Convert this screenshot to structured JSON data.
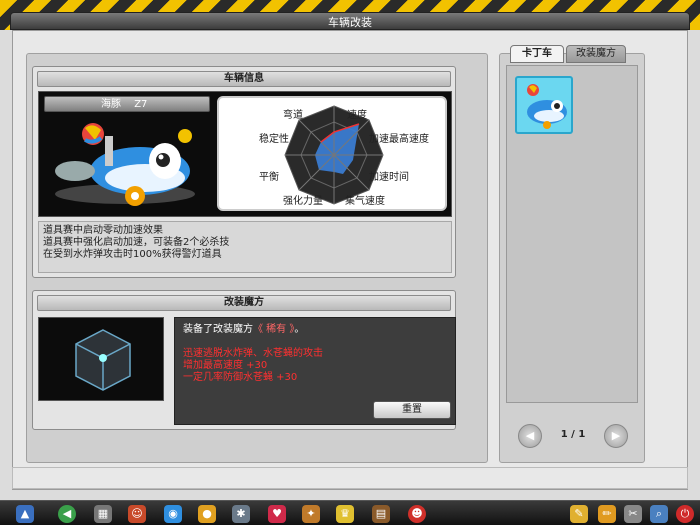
{
  "window": {
    "title": "车辆改装"
  },
  "vehicle_info": {
    "header": "车辆信息",
    "vehicle_name": "海豚",
    "vehicle_level": "Z7",
    "radar_labels": {
      "curve": "弯道",
      "speed": "速度",
      "stability": "稳定性",
      "accel_top_speed": "加速最高速度",
      "balance": "平衡",
      "accel_time": "加速时间",
      "boost_power": "强化力量",
      "gas_speed": "集气速度"
    },
    "description": [
      "道具赛中启动零动加速效果",
      "道具赛中强化启动加速，可装备2个必杀技",
      "在受到水炸弹攻击时100%获得警灯道具"
    ]
  },
  "modification": {
    "header": "改装魔方",
    "equipped_prefix": "装备了改装魔方",
    "equipped_name": "《 稀有 》",
    "equipped_suffix": "。",
    "effects": [
      "迅速逃脱水炸弹、水苍蝇的攻击",
      "增加最高速度 +30",
      "一定几率防御水苍蝇 +30"
    ],
    "reset_button": "重置"
  },
  "right_panel": {
    "tabs": [
      {
        "label": "卡丁车",
        "active": true
      },
      {
        "label": "改装魔方",
        "active": false
      }
    ],
    "pager": {
      "current": "1",
      "separator": "/",
      "total": "1",
      "prev": "◀",
      "next": "▶"
    }
  },
  "colors": {
    "accent_yellow": "#f2c200",
    "effect_red": "#ff3030",
    "rare_name": "#ff6666",
    "slot_bg": "#6bd7f0"
  },
  "taskbar": {
    "icons": [
      "menu-icon",
      "back-icon",
      "cart-icon",
      "character-icon",
      "car-icon",
      "gear-icon",
      "heart-icon",
      "item-icon",
      "cup-icon",
      "book-icon",
      "face-icon",
      "notepad-icon",
      "edit-icon",
      "tools-icon",
      "search-icon",
      "power-icon"
    ]
  }
}
